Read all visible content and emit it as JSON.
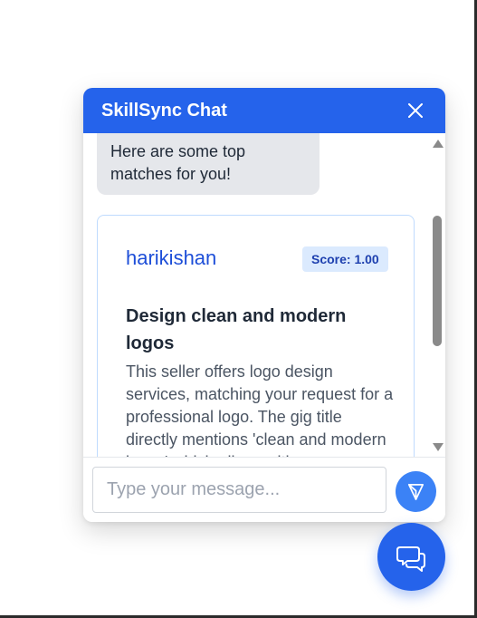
{
  "chat": {
    "title": "SkillSync Chat",
    "close_icon": "close-icon",
    "messages": [
      {
        "sender": "bot",
        "text": "Here are some top matches for you!"
      }
    ],
    "matches": [
      {
        "seller": "harikishan",
        "score_label": "Score: 1.00",
        "score": 1.0,
        "gig_title": "Design clean and modern logos",
        "description": "This seller offers logo design services, matching your request for a professional logo. The gig title directly mentions 'clean and modern logos' which aligns with your..."
      }
    ],
    "input": {
      "placeholder": "Type your message...",
      "value": ""
    },
    "send_icon": "send-icon",
    "toggle_icon": "chat-bubbles-icon"
  },
  "colors": {
    "header": "#2563eb",
    "accent": "#3b82f6",
    "seller_link": "#1d4ed8",
    "badge_bg": "#dbeafe",
    "bot_bubble": "#e5e7eb"
  }
}
